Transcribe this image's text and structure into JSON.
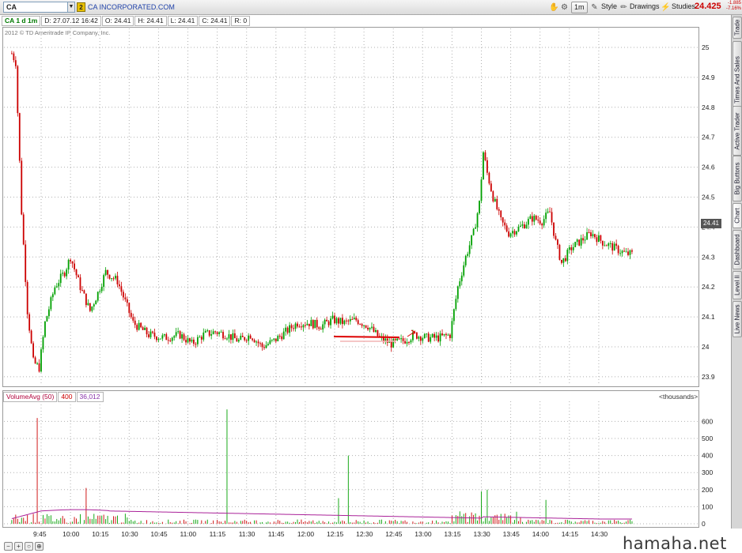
{
  "toolbar": {
    "symbol": "CA",
    "link_badge": "2",
    "company": "CA INCORPORATED.COM",
    "timeframe_btn": "1m",
    "style_label": "Style",
    "drawings_label": "Drawings",
    "studies_label": "Studies",
    "last_price": "24.425",
    "net_change": "-1.885",
    "pct_change": "-7.16%"
  },
  "info": {
    "timeframe": "CA 1 d 1m",
    "date": "D: 27.07.12 16:42",
    "open": "O: 24.41",
    "high": "H: 24.41",
    "low": "L: 24.41",
    "close": "C: 24.41",
    "range": "R: 0"
  },
  "copyright": "2012 © TD Ameritrade IP Company, Inc.",
  "current_price_tag": "24.41",
  "volume_header": {
    "label": "VolumeAvg (50)",
    "value1": "400",
    "value2": "36,012",
    "units": "<thousands>"
  },
  "side_tabs": [
    "Trade",
    "Times And Sales",
    "Active Trader",
    "Big Buttons",
    "Chart",
    "Dashboard",
    "Level II",
    "Live News"
  ],
  "watermark": "hamaha.net",
  "colors": {
    "up": "#00a000",
    "down": "#cc0000",
    "avg_line": "#aa2299",
    "grid": "#b0b0b0",
    "annotation": "#dd0000"
  },
  "chart_data": [
    {
      "type": "candlestick",
      "title": "",
      "x_ticks": [
        "9:45",
        "10:00",
        "10:15",
        "10:30",
        "10:45",
        "11:00",
        "11:15",
        "11:30",
        "11:45",
        "12:00",
        "12:15",
        "12:30",
        "12:45",
        "13:00",
        "13:15",
        "13:30",
        "13:45",
        "14:00",
        "14:15",
        "14:30"
      ],
      "y_ticks": [
        "25",
        "24.9",
        "24.8",
        "24.7",
        "24.6",
        "24.5",
        "24.4",
        "24.3",
        "24.2",
        "24.1",
        "24",
        "23.9"
      ],
      "ylim": [
        23.86,
        25.08
      ],
      "grid": true,
      "price_path": [
        [
          "9:30",
          24.98
        ],
        [
          "9:32",
          24.95
        ],
        [
          "9:35",
          24.45
        ],
        [
          "9:38",
          24.12
        ],
        [
          "9:41",
          23.95
        ],
        [
          "9:44",
          23.93
        ],
        [
          "9:47",
          24.08
        ],
        [
          "9:52",
          24.2
        ],
        [
          "9:57",
          24.25
        ],
        [
          "10:00",
          24.3
        ],
        [
          "10:05",
          24.2
        ],
        [
          "10:10",
          24.12
        ],
        [
          "10:14",
          24.18
        ],
        [
          "10:18",
          24.25
        ],
        [
          "10:24",
          24.22
        ],
        [
          "10:28",
          24.15
        ],
        [
          "10:32",
          24.08
        ],
        [
          "10:40",
          24.04
        ],
        [
          "10:48",
          24.03
        ],
        [
          "10:56",
          24.04
        ],
        [
          "11:02",
          24.01
        ],
        [
          "11:08",
          24.04
        ],
        [
          "11:14",
          24.05
        ],
        [
          "11:20",
          24.04
        ],
        [
          "11:26",
          24.02
        ],
        [
          "11:32",
          24.04
        ],
        [
          "11:38",
          24.0
        ],
        [
          "11:44",
          24.02
        ],
        [
          "11:50",
          24.05
        ],
        [
          "11:56",
          24.08
        ],
        [
          "12:02",
          24.08
        ],
        [
          "12:08",
          24.07
        ],
        [
          "12:14",
          24.09
        ],
        [
          "12:20",
          24.08
        ],
        [
          "12:26",
          24.09
        ],
        [
          "12:32",
          24.07
        ],
        [
          "12:38",
          24.03
        ],
        [
          "12:44",
          24.01
        ],
        [
          "12:50",
          24.02
        ],
        [
          "12:56",
          24.04
        ],
        [
          "13:02",
          24.03
        ],
        [
          "13:08",
          24.03
        ],
        [
          "13:14",
          24.04
        ],
        [
          "13:18",
          24.2
        ],
        [
          "13:22",
          24.3
        ],
        [
          "13:26",
          24.38
        ],
        [
          "13:29",
          24.48
        ],
        [
          "13:31",
          24.65
        ],
        [
          "13:33",
          24.58
        ],
        [
          "13:36",
          24.5
        ],
        [
          "13:40",
          24.42
        ],
        [
          "13:44",
          24.38
        ],
        [
          "13:50",
          24.4
        ],
        [
          "13:56",
          24.43
        ],
        [
          "14:01",
          24.42
        ],
        [
          "14:05",
          24.45
        ],
        [
          "14:08",
          24.35
        ],
        [
          "14:11",
          24.28
        ],
        [
          "14:16",
          24.33
        ],
        [
          "14:22",
          24.36
        ],
        [
          "14:26",
          24.38
        ],
        [
          "14:32",
          24.35
        ],
        [
          "14:38",
          24.33
        ],
        [
          "14:44",
          24.31
        ]
      ]
    },
    {
      "type": "bar",
      "title": "VolumeAvg (50)",
      "ylabel": "<thousands>",
      "y_ticks": [
        "600",
        "500",
        "400",
        "300",
        "200",
        "100",
        "0"
      ],
      "ylim": [
        0,
        650
      ],
      "notable_spikes": [
        {
          "time": "9:43",
          "value": 620
        },
        {
          "time": "10:08",
          "value": 210
        },
        {
          "time": "11:20",
          "value": 670
        },
        {
          "time": "12:22",
          "value": 400
        },
        {
          "time": "12:17",
          "value": 150
        },
        {
          "time": "13:30",
          "value": 190
        },
        {
          "time": "13:33",
          "value": 200
        },
        {
          "time": "14:03",
          "value": 140
        }
      ],
      "avg_level": 90
    }
  ]
}
